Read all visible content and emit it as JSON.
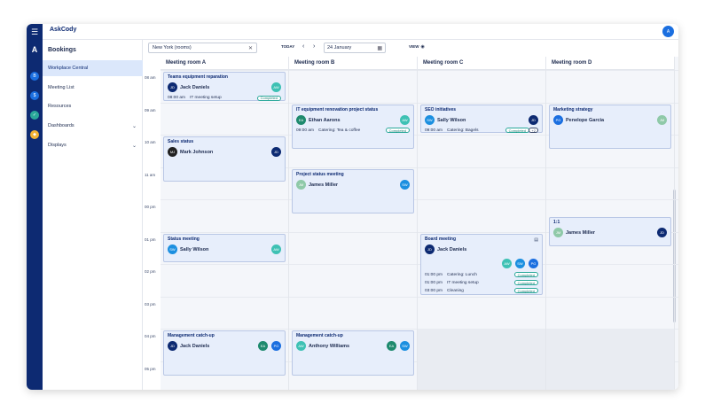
{
  "app": {
    "name": "AskCody",
    "user_initials": "A"
  },
  "rail_icons": [
    {
      "name": "logo-icon",
      "glyph": "A",
      "color": "#0d2a72"
    },
    {
      "name": "bookings-icon",
      "glyph": "B",
      "color": "#1b6fe0"
    },
    {
      "name": "dollar-icon",
      "glyph": "$",
      "color": "#1b6fe0"
    },
    {
      "name": "check-icon",
      "glyph": "✓",
      "color": "#2aa89a"
    },
    {
      "name": "cube-icon",
      "glyph": "◆",
      "color": "#f2b234"
    }
  ],
  "sidebar": {
    "title": "Bookings",
    "items": [
      {
        "label": "Workplace Central",
        "active": true,
        "chevron": false
      },
      {
        "label": "Meeting List",
        "active": false,
        "chevron": false
      },
      {
        "label": "Resources",
        "active": false,
        "chevron": false
      },
      {
        "label": "Dashboards",
        "active": false,
        "chevron": true
      },
      {
        "label": "Displays",
        "active": false,
        "chevron": true
      }
    ]
  },
  "toolbar": {
    "location": "New York (rooms)",
    "today_label": "TODAY",
    "date": "24 January",
    "view_label": "VIEW"
  },
  "times": [
    "08 am",
    "09 am",
    "10 am",
    "11 am",
    "00 pm",
    "01 pm",
    "02 pm",
    "03 pm",
    "04 pm",
    "05 pm"
  ],
  "rooms": [
    "Meeting room A",
    "Meeting room B",
    "Meeting room C",
    "Meeting room D"
  ],
  "events": [
    {
      "room": 0,
      "start": 0,
      "span": 1.0,
      "title": "Teams equipment reparation",
      "organizer": {
        "initials": "JD",
        "name": "Jack Daniels",
        "color": "#0d2a72"
      },
      "attendees": [
        {
          "initials": "AW",
          "color": "#3ec1b4"
        }
      ],
      "services": [
        {
          "time": "08:00 am",
          "text": "IT meeting setup",
          "status": "Completed"
        }
      ]
    },
    {
      "room": 0,
      "start": 2.0,
      "span": 1.5,
      "title": "Sales status",
      "organizer": {
        "initials": "MJ",
        "name": "Mark Johnson",
        "color": "#222222"
      },
      "attendees": [
        {
          "initials": "JD",
          "color": "#0d2a72"
        }
      ],
      "services": []
    },
    {
      "room": 0,
      "start": 5.0,
      "span": 1.0,
      "title": "Status meeting",
      "organizer": {
        "initials": "SW",
        "name": "Sally Wilson",
        "color": "#1b8fe0"
      },
      "attendees": [
        {
          "initials": "AW",
          "color": "#3ec1b4"
        }
      ],
      "services": []
    },
    {
      "room": 0,
      "start": 8.0,
      "span": 1.5,
      "title": "Management catch-up",
      "organizer": {
        "initials": "JD",
        "name": "Jack Daniels",
        "color": "#0d2a72"
      },
      "attendees": [
        {
          "initials": "EA",
          "color": "#1e8a6e"
        },
        {
          "initials": "PG",
          "color": "#1b6fe0"
        }
      ],
      "services": []
    },
    {
      "room": 1,
      "start": 1.0,
      "span": 1.5,
      "title": "IT equipment renovation project status",
      "organizer": {
        "initials": "EA",
        "name": "Ethan Aarons",
        "color": "#1e8a6e"
      },
      "attendees": [
        {
          "initials": "AW",
          "color": "#3ec1b4"
        }
      ],
      "services": [
        {
          "time": "09:00 am",
          "text": "Catering: Tea & coffee",
          "status": "Completed"
        }
      ]
    },
    {
      "room": 1,
      "start": 3.0,
      "span": 1.5,
      "title": "Project status meeting",
      "organizer": {
        "initials": "JM",
        "name": "James Miller",
        "color": "#8fc9a8"
      },
      "attendees": [
        {
          "initials": "SW",
          "color": "#1b8fe0"
        }
      ],
      "services": []
    },
    {
      "room": 1,
      "start": 8.0,
      "span": 1.5,
      "title": "Management catch-up",
      "organizer": {
        "initials": "AW",
        "name": "Anthony Williams",
        "color": "#3ec1b4"
      },
      "attendees": [
        {
          "initials": "EA",
          "color": "#1e8a6e"
        },
        {
          "initials": "SW",
          "color": "#1b8fe0"
        }
      ],
      "services": []
    },
    {
      "room": 2,
      "start": 1.0,
      "span": 1.0,
      "title": "SEO initiatives",
      "organizer": {
        "initials": "SW",
        "name": "Sally Wilson",
        "color": "#1b8fe0"
      },
      "attendees": [
        {
          "initials": "JD",
          "color": "#0d2a72"
        }
      ],
      "services": [
        {
          "time": "09:00 am",
          "text": "Catering: Bagels",
          "status": "Completed",
          "extra": "+2"
        }
      ]
    },
    {
      "room": 2,
      "start": 5.0,
      "span": 2.0,
      "title": "Board meeting",
      "organizer": {
        "initials": "JD",
        "name": "Jack Daniels",
        "color": "#0d2a72"
      },
      "attendees": [
        {
          "initials": "AW",
          "color": "#3ec1b4"
        },
        {
          "initials": "SW",
          "color": "#1b8fe0"
        },
        {
          "initials": "PG",
          "color": "#1b6fe0"
        }
      ],
      "services": [
        {
          "time": "01:00 pm",
          "text": "Catering: Lunch",
          "status": "Completed"
        },
        {
          "time": "01:00 pm",
          "text": "IT meeting setup",
          "status": "Completed"
        },
        {
          "time": "03:00 pm",
          "text": "Cleaning",
          "status": "Completed"
        }
      ],
      "doc": true
    },
    {
      "room": 3,
      "start": 1.0,
      "span": 1.5,
      "title": "Marketing strategy",
      "organizer": {
        "initials": "PG",
        "name": "Penelope Garcia",
        "color": "#1b6fe0"
      },
      "attendees": [
        {
          "initials": "JM",
          "color": "#8fc9a8"
        }
      ],
      "services": []
    },
    {
      "room": 3,
      "start": 4.5,
      "span": 1.0,
      "title": "1:1",
      "organizer": {
        "initials": "JM",
        "name": "James Miller",
        "color": "#8fc9a8"
      },
      "attendees": [
        {
          "initials": "JD",
          "color": "#0d2a72"
        }
      ],
      "services": []
    }
  ]
}
